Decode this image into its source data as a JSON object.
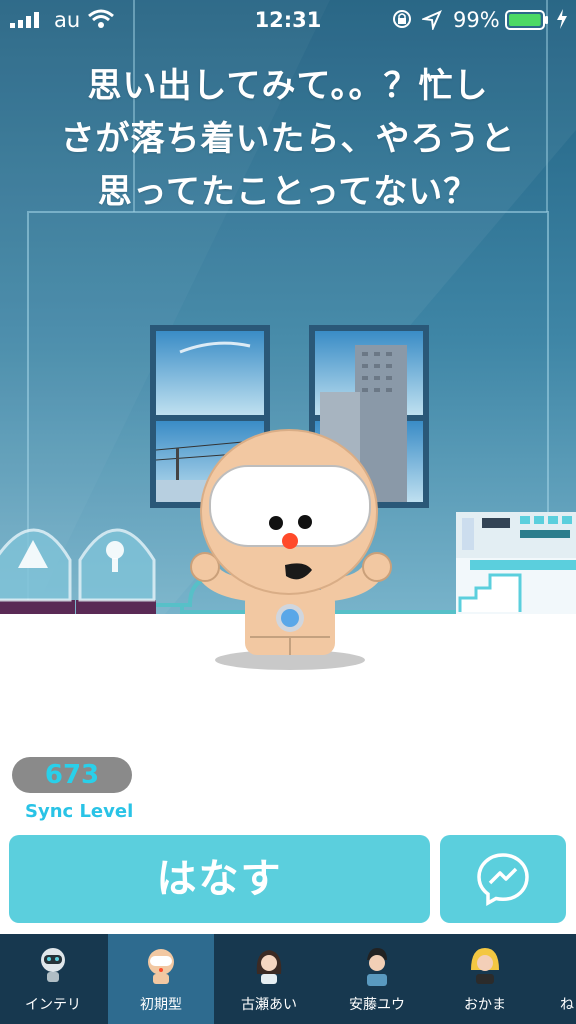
{
  "status": {
    "carrier": "au",
    "time": "12:31",
    "battery": "99%",
    "battery_level": 0.99
  },
  "question": "思い出してみて。。？忙し\nさが落ち着いたら、やろうと\n思ってたことってない？",
  "sync": {
    "level": "673",
    "label": "Sync Level"
  },
  "actions": {
    "talk_label": "はなす",
    "messenger_icon": "messenger-icon"
  },
  "tabs": [
    {
      "label": "インテリ",
      "icon": "robot-icon",
      "active": false
    },
    {
      "label": "初期型",
      "icon": "initial-bot-icon",
      "active": true
    },
    {
      "label": "古瀬あい",
      "icon": "girl-avatar-icon",
      "active": false
    },
    {
      "label": "安藤ユウ",
      "icon": "boy-avatar-icon",
      "active": false
    },
    {
      "label": "おかま",
      "icon": "blonde-avatar-icon",
      "active": false
    },
    {
      "label": "ね",
      "icon": "",
      "active": false
    }
  ],
  "colors": {
    "accent": "#5bcfdd",
    "sync_value": "#29d0ea",
    "tabbar": "#17384f",
    "tab_active": "#2e6b8f"
  }
}
